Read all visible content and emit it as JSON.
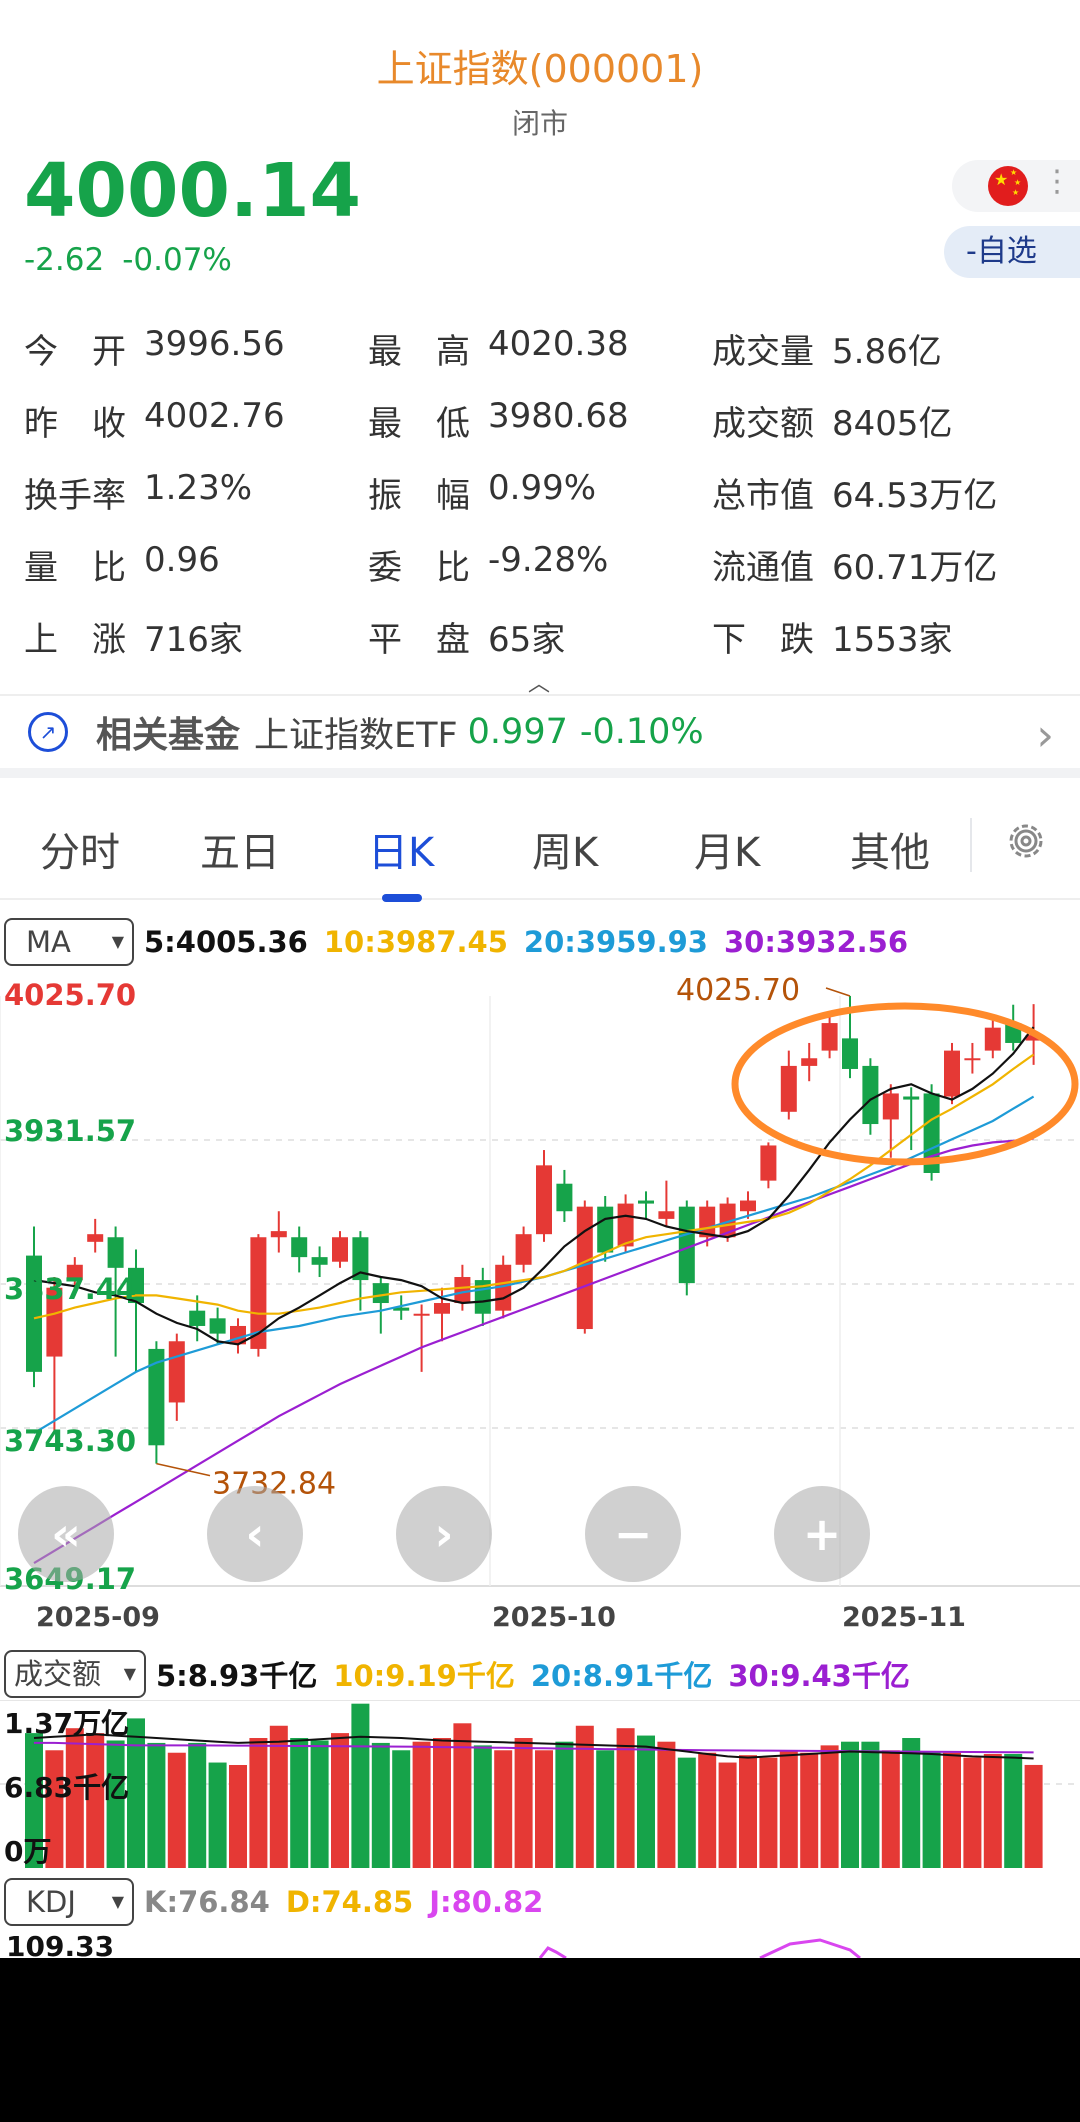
{
  "header": {
    "title": "上证指数(000001)",
    "status": "闭市"
  },
  "quote": {
    "price": "4000.14",
    "change": "-2.62",
    "change_pct": "-0.07%",
    "watchlist_label": "-自选"
  },
  "stats": [
    [
      {
        "label": "今　开",
        "value": "3996.56"
      },
      {
        "label": "最　高",
        "value": "4020.38"
      },
      {
        "label": "成交量",
        "value": "5.86亿"
      }
    ],
    [
      {
        "label": "昨　收",
        "value": "4002.76"
      },
      {
        "label": "最　低",
        "value": "3980.68"
      },
      {
        "label": "成交额",
        "value": "8405亿"
      }
    ],
    [
      {
        "label": "换手率",
        "value": "1.23%"
      },
      {
        "label": "振　幅",
        "value": "0.99%"
      },
      {
        "label": "总市值",
        "value": "64.53万亿"
      }
    ],
    [
      {
        "label": "量　比",
        "value": "0.96"
      },
      {
        "label": "委　比",
        "value": "-9.28%"
      },
      {
        "label": "流通值",
        "value": "60.71万亿"
      }
    ],
    [
      {
        "label": "上　涨",
        "value": "716家"
      },
      {
        "label": "平　盘",
        "value": "65家"
      },
      {
        "label": "下　跌",
        "value": "1553家"
      }
    ]
  ],
  "fund": {
    "label": "相关基金",
    "name": "上证指数ETF",
    "price": "0.997",
    "change_pct": "-0.10%"
  },
  "tabs": [
    "分时",
    "五日",
    "日K",
    "周K",
    "月K",
    "其他"
  ],
  "active_tab": 2,
  "colors": {
    "up": "#e53935",
    "down": "#16a34a",
    "ma5": "#111111",
    "ma10": "#f0b400",
    "ma20": "#1e9bd7",
    "ma30": "#9b1fd1",
    "accent": "#1d4ed8",
    "title": "#e8892b",
    "annotation": "#ff8a2a"
  },
  "main_indicator": {
    "selector": "MA",
    "items": [
      {
        "text": "5:4005.36",
        "color": "#111111"
      },
      {
        "text": "10:3987.45",
        "color": "#f0b400"
      },
      {
        "text": "20:3959.93",
        "color": "#1e9bd7"
      },
      {
        "text": "30:3932.56",
        "color": "#9b1fd1"
      }
    ]
  },
  "y_labels": [
    {
      "text": "4025.70",
      "color": "#e53935"
    },
    {
      "text": "3931.57",
      "color": "#16a34a"
    },
    {
      "text": "3837.44",
      "color": "#16a34a"
    },
    {
      "text": "3743.30",
      "color": "#16a34a"
    },
    {
      "text": "3649.17",
      "color": "#16a34a"
    }
  ],
  "max_annotation": "4025.70",
  "min_annotation": "3732.84",
  "x_labels": [
    "2025-09",
    "2025-10",
    "2025-11"
  ],
  "volume_indicator": {
    "selector": "成交额",
    "items": [
      {
        "text": "5:8.93千亿",
        "color": "#111111"
      },
      {
        "text": "10:9.19千亿",
        "color": "#f0b400"
      },
      {
        "text": "20:8.91千亿",
        "color": "#1e9bd7"
      },
      {
        "text": "30:9.43千亿",
        "color": "#9b1fd1"
      }
    ],
    "y_labels": [
      "1.37万亿",
      "6.83千亿",
      "0万"
    ]
  },
  "kdj_indicator": {
    "selector": "KDJ",
    "items": [
      {
        "text": "K:76.84",
        "color": "#888888"
      },
      {
        "text": "D:74.85",
        "color": "#f0b400"
      },
      {
        "text": "J:80.82",
        "color": "#d946ef"
      }
    ],
    "top_value": "109.33"
  },
  "chart_data": {
    "type": "candlestick",
    "ylim": [
      3649.17,
      4025.7
    ],
    "x_ticks": [
      "2025-09",
      "2025-10",
      "2025-11"
    ],
    "candles": [
      {
        "o": 3856,
        "c": 3780,
        "h": 3875,
        "l": 3770
      },
      {
        "o": 3790,
        "c": 3835,
        "h": 3842,
        "l": 3740
      },
      {
        "o": 3840,
        "c": 3850,
        "h": 3855,
        "l": 3830
      },
      {
        "o": 3865,
        "c": 3870,
        "h": 3880,
        "l": 3858
      },
      {
        "o": 3868,
        "c": 3848,
        "h": 3875,
        "l": 3790
      },
      {
        "o": 3848,
        "c": 3825,
        "h": 3860,
        "l": 3780
      },
      {
        "o": 3795,
        "c": 3732,
        "h": 3800,
        "l": 3720
      },
      {
        "o": 3760,
        "c": 3800,
        "h": 3805,
        "l": 3748
      },
      {
        "o": 3820,
        "c": 3810,
        "h": 3830,
        "l": 3800
      },
      {
        "o": 3815,
        "c": 3805,
        "h": 3822,
        "l": 3798
      },
      {
        "o": 3798,
        "c": 3810,
        "h": 3815,
        "l": 3792
      },
      {
        "o": 3795,
        "c": 3868,
        "h": 3870,
        "l": 3790
      },
      {
        "o": 3868,
        "c": 3872,
        "h": 3885,
        "l": 3858
      },
      {
        "o": 3868,
        "c": 3855,
        "h": 3875,
        "l": 3845
      },
      {
        "o": 3855,
        "c": 3850,
        "h": 3862,
        "l": 3842
      },
      {
        "o": 3852,
        "c": 3868,
        "h": 3872,
        "l": 3848
      },
      {
        "o": 3868,
        "c": 3840,
        "h": 3872,
        "l": 3820
      },
      {
        "o": 3838,
        "c": 3825,
        "h": 3842,
        "l": 3805
      },
      {
        "o": 3822,
        "c": 3820,
        "h": 3830,
        "l": 3814
      },
      {
        "o": 3818,
        "c": 3818,
        "h": 3824,
        "l": 3780
      },
      {
        "o": 3818,
        "c": 3825,
        "h": 3835,
        "l": 3800
      },
      {
        "o": 3825,
        "c": 3842,
        "h": 3850,
        "l": 3820
      },
      {
        "o": 3840,
        "c": 3818,
        "h": 3848,
        "l": 3810
      },
      {
        "o": 3820,
        "c": 3850,
        "h": 3856,
        "l": 3815
      },
      {
        "o": 3850,
        "c": 3870,
        "h": 3875,
        "l": 3845
      },
      {
        "o": 3870,
        "c": 3915,
        "h": 3925,
        "l": 3865
      },
      {
        "o": 3903,
        "c": 3885,
        "h": 3912,
        "l": 3878
      },
      {
        "o": 3808,
        "c": 3888,
        "h": 3892,
        "l": 3805
      },
      {
        "o": 3888,
        "c": 3858,
        "h": 3895,
        "l": 3852
      },
      {
        "o": 3862,
        "c": 3890,
        "h": 3896,
        "l": 3858
      },
      {
        "o": 3892,
        "c": 3890,
        "h": 3898,
        "l": 3880
      },
      {
        "o": 3880,
        "c": 3885,
        "h": 3905,
        "l": 3875
      },
      {
        "o": 3888,
        "c": 3838,
        "h": 3892,
        "l": 3830
      },
      {
        "o": 3868,
        "c": 3888,
        "h": 3892,
        "l": 3862
      },
      {
        "o": 3868,
        "c": 3890,
        "h": 3894,
        "l": 3865
      },
      {
        "o": 3885,
        "c": 3892,
        "h": 3898,
        "l": 3880
      },
      {
        "o": 3905,
        "c": 3928,
        "h": 3930,
        "l": 3900
      },
      {
        "o": 3950,
        "c": 3980,
        "h": 3990,
        "l": 3945
      },
      {
        "o": 3980,
        "c": 3985,
        "h": 3995,
        "l": 3970
      },
      {
        "o": 3990,
        "c": 4008,
        "h": 4015,
        "l": 3985
      },
      {
        "o": 3998,
        "c": 3978,
        "h": 4025.7,
        "l": 3972
      },
      {
        "o": 3980,
        "c": 3942,
        "h": 3985,
        "l": 3935
      },
      {
        "o": 3945,
        "c": 3962,
        "h": 3968,
        "l": 3920
      },
      {
        "o": 3960,
        "c": 3958,
        "h": 3966,
        "l": 3925
      },
      {
        "o": 3962,
        "c": 3910,
        "h": 3968,
        "l": 3905
      },
      {
        "o": 3960,
        "c": 3990,
        "h": 3995,
        "l": 3955
      },
      {
        "o": 3985,
        "c": 3985,
        "h": 3995,
        "l": 3975
      },
      {
        "o": 3990,
        "c": 4005,
        "h": 4012,
        "l": 3985
      },
      {
        "o": 4008,
        "c": 3995,
        "h": 4020,
        "l": 3990
      },
      {
        "o": 3996.56,
        "c": 4000.14,
        "h": 4020.38,
        "l": 3980.68
      }
    ],
    "ma5": [
      3840,
      3838,
      3836,
      3832,
      3830,
      3826,
      3818,
      3812,
      3808,
      3800,
      3798,
      3805,
      3815,
      3822,
      3830,
      3838,
      3845,
      3842,
      3840,
      3836,
      3828,
      3825,
      3826,
      3828,
      3835,
      3848,
      3862,
      3872,
      3880,
      3882,
      3880,
      3875,
      3872,
      3870,
      3868,
      3872,
      3880,
      3895,
      3912,
      3930,
      3945,
      3958,
      3965,
      3968,
      3962,
      3958,
      3965,
      3975,
      3988,
      4005.36
    ],
    "ma10": [
      3815,
      3818,
      3822,
      3825,
      3828,
      3830,
      3830,
      3828,
      3826,
      3824,
      3820,
      3818,
      3818,
      3820,
      3822,
      3825,
      3828,
      3830,
      3832,
      3833,
      3834,
      3835,
      3836,
      3838,
      3840,
      3842,
      3846,
      3852,
      3858,
      3864,
      3868,
      3870,
      3872,
      3874,
      3876,
      3878,
      3880,
      3884,
      3890,
      3898,
      3906,
      3915,
      3925,
      3935,
      3945,
      3952,
      3960,
      3968,
      3978,
      3987.45
    ],
    "ma20": [
      3740,
      3748,
      3756,
      3764,
      3772,
      3780,
      3786,
      3790,
      3794,
      3798,
      3802,
      3806,
      3808,
      3810,
      3813,
      3816,
      3818,
      3820,
      3823,
      3826,
      3829,
      3832,
      3834,
      3836,
      3839,
      3842,
      3846,
      3850,
      3854,
      3858,
      3862,
      3866,
      3870,
      3874,
      3878,
      3882,
      3886,
      3890,
      3894,
      3899,
      3904,
      3909,
      3914,
      3920,
      3926,
      3932,
      3938,
      3944,
      3952,
      3959.93
    ],
    "ma30": [
      3655,
      3663,
      3671,
      3679,
      3687,
      3695,
      3703,
      3711,
      3719,
      3727,
      3735,
      3743,
      3751,
      3758,
      3765,
      3772,
      3778,
      3784,
      3790,
      3796,
      3801,
      3806,
      3811,
      3816,
      3821,
      3826,
      3831,
      3836,
      3841,
      3846,
      3851,
      3856,
      3861,
      3866,
      3871,
      3876,
      3881,
      3886,
      3891,
      3896,
      3901,
      3906,
      3911,
      3916,
      3921,
      3925,
      3928,
      3930,
      3931,
      3932.56
    ],
    "volume": {
      "ylim": [
        0,
        13700
      ],
      "unit": "亿",
      "values": [
        11000,
        9600,
        11400,
        11000,
        10400,
        12200,
        10200,
        9400,
        10200,
        8600,
        8400,
        10600,
        11600,
        10600,
        10400,
        11000,
        13400,
        10200,
        9600,
        10300,
        10600,
        11800,
        10000,
        9600,
        10600,
        9600,
        10300,
        11600,
        9600,
        11400,
        10800,
        10300,
        9000,
        9400,
        8600,
        9200,
        9000,
        9600,
        9400,
        10000,
        10300,
        10300,
        9600,
        10600,
        9500,
        9400,
        9000,
        9300,
        9300,
        8405
      ],
      "ma5": [
        10600,
        10700,
        10800,
        10900,
        10800,
        10700,
        10600,
        10500,
        10400,
        10300,
        10200,
        10250,
        10300,
        10400,
        10500,
        10600,
        10700,
        10650,
        10600,
        10500,
        10400,
        10350,
        10300,
        10250,
        10200,
        10150,
        10100,
        10050,
        10000,
        9950,
        9900,
        9700,
        9500,
        9300,
        9100,
        9000,
        9100,
        9200,
        9300,
        9400,
        9500,
        9450,
        9400,
        9350,
        9300,
        9200,
        9100,
        9050,
        9000,
        8930
      ],
      "ma30": [
        10200,
        10200,
        10150,
        10100,
        10050,
        10000,
        10000,
        10000,
        10000,
        9990,
        9980,
        9970,
        9960,
        9950,
        9940,
        9930,
        9920,
        9910,
        9900,
        9880,
        9860,
        9840,
        9820,
        9800,
        9780,
        9760,
        9740,
        9720,
        9700,
        9680,
        9660,
        9640,
        9620,
        9600,
        9590,
        9580,
        9570,
        9560,
        9550,
        9540,
        9530,
        9510,
        9500,
        9490,
        9480,
        9470,
        9460,
        9450,
        9440,
        9430
      ]
    }
  }
}
